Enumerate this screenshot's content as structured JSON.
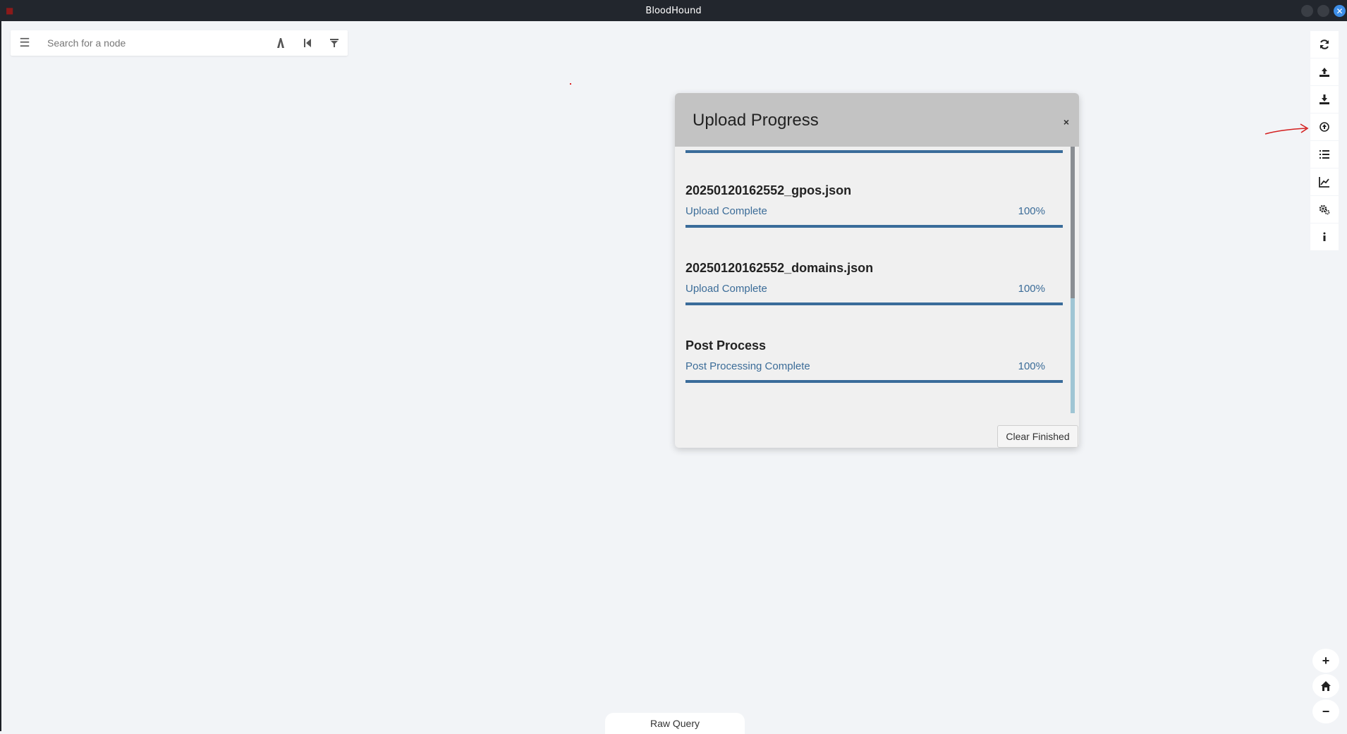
{
  "window": {
    "title": "BloodHound",
    "controls": [
      "minimize-icon",
      "maximize-icon",
      "close-icon"
    ]
  },
  "search": {
    "placeholder": "Search for a node",
    "menu_icon": "hamburger-icon",
    "tools": [
      "pathfinding-icon",
      "back-icon",
      "filter-icon"
    ]
  },
  "modal": {
    "title": "Upload Progress",
    "close_label": "×",
    "items": [
      {
        "name": "20250120162552_gpos.json",
        "status": "Upload Complete",
        "percent_label": "100%",
        "progress": 1.0
      },
      {
        "name": "20250120162552_domains.json",
        "status": "Upload Complete",
        "percent_label": "100%",
        "progress": 1.0
      },
      {
        "name": "Post Process",
        "status": "Post Processing Complete",
        "percent_label": "100%",
        "progress": 1.0
      }
    ],
    "clear_button": "Clear Finished"
  },
  "right_toolbar": [
    "refresh-icon",
    "upload-icon",
    "export-icon",
    "upload-progress-icon",
    "queries-icon",
    "analytics-icon",
    "settings-icon",
    "info-icon"
  ],
  "zoom": {
    "zoom_in": "+",
    "home_icon": "home-icon",
    "zoom_out": "−"
  },
  "raw_query": {
    "label": "Raw Query"
  },
  "colors": {
    "accent": "#3a6c9a",
    "annotation": "#d42020",
    "titlebar": "#22262d"
  }
}
